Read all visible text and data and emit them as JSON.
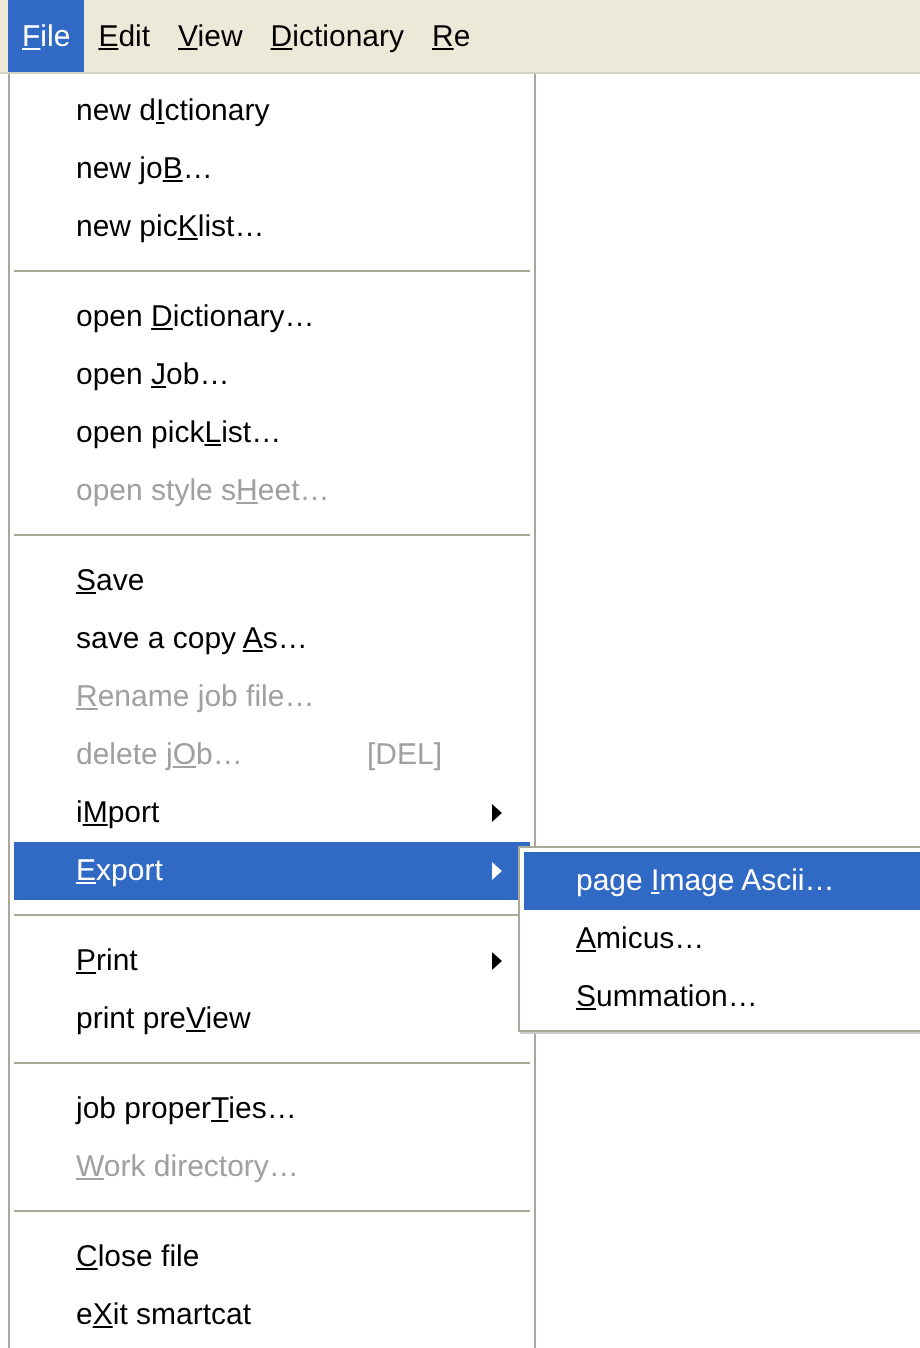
{
  "menu_bar": [
    {
      "label": {
        "key": "F",
        "after": "ile"
      },
      "selected": true
    },
    {
      "label": {
        "key": "E",
        "after": "dit"
      },
      "selected": false
    },
    {
      "label": {
        "key": "V",
        "after": "iew"
      },
      "selected": false
    },
    {
      "label": {
        "key": "D",
        "after": "ictionary"
      },
      "selected": false
    },
    {
      "label": {
        "key": "R",
        "after": "e"
      },
      "selected": false
    }
  ],
  "file_menu": [
    {
      "kind": "item",
      "label": {
        "before": "new d",
        "key": "I",
        "after": "ctionary"
      },
      "disabled": false,
      "selected": false
    },
    {
      "kind": "item",
      "label": {
        "before": "new jo",
        "key": "B",
        "after": "…"
      },
      "disabled": false,
      "selected": false
    },
    {
      "kind": "item",
      "label": {
        "before": "new pic",
        "key": "K",
        "after": "list…"
      },
      "disabled": false,
      "selected": false
    },
    {
      "kind": "separator"
    },
    {
      "kind": "item",
      "label": {
        "before": "open ",
        "key": "D",
        "after": "ictionary…"
      },
      "disabled": false,
      "selected": false
    },
    {
      "kind": "item",
      "label": {
        "before": "open ",
        "key": "J",
        "after": "ob…"
      },
      "disabled": false,
      "selected": false
    },
    {
      "kind": "item",
      "label": {
        "before": "open pick",
        "key": "L",
        "after": "ist…"
      },
      "disabled": false,
      "selected": false
    },
    {
      "kind": "item",
      "label": {
        "before": "open style s",
        "key": "H",
        "after": "eet…"
      },
      "disabled": true,
      "selected": false
    },
    {
      "kind": "separator"
    },
    {
      "kind": "item",
      "label": {
        "key": "S",
        "after": "ave"
      },
      "disabled": false,
      "selected": false
    },
    {
      "kind": "item",
      "label": {
        "before": "save a copy ",
        "key": "A",
        "after": "s…"
      },
      "disabled": false,
      "selected": false
    },
    {
      "kind": "item",
      "label": {
        "key": "R",
        "after": "ename job file…"
      },
      "disabled": true,
      "selected": false
    },
    {
      "kind": "item",
      "label": {
        "before": "delete j",
        "key": "O",
        "after": "b…"
      },
      "shortcut": "[DEL]",
      "disabled": true,
      "selected": false
    },
    {
      "kind": "submenu",
      "label": {
        "before": "i",
        "key": "M",
        "after": "port"
      },
      "disabled": false,
      "selected": false
    },
    {
      "kind": "submenu",
      "label": {
        "key": "E",
        "after": "xport"
      },
      "disabled": false,
      "selected": true,
      "children": [
        {
          "label": {
            "before": "page ",
            "key": "I",
            "after": "mage Ascii…"
          },
          "selected": true
        },
        {
          "label": {
            "key": "A",
            "after": "micus…"
          },
          "selected": false
        },
        {
          "label": {
            "key": "S",
            "after": "ummation…"
          },
          "selected": false
        }
      ]
    },
    {
      "kind": "separator"
    },
    {
      "kind": "submenu",
      "label": {
        "key": "P",
        "after": "rint"
      },
      "disabled": false,
      "selected": false
    },
    {
      "kind": "item",
      "label": {
        "before": "print pre",
        "key": "V",
        "after": "iew"
      },
      "disabled": false,
      "selected": false
    },
    {
      "kind": "separator"
    },
    {
      "kind": "item",
      "label": {
        "before": "job proper",
        "key": "T",
        "after": "ies…"
      },
      "disabled": false,
      "selected": false
    },
    {
      "kind": "item",
      "label": {
        "key": "W",
        "after": "ork directory…"
      },
      "disabled": true,
      "selected": false
    },
    {
      "kind": "separator"
    },
    {
      "kind": "item",
      "label": {
        "key": "C",
        "after": "lose file"
      },
      "disabled": false,
      "selected": false
    },
    {
      "kind": "item",
      "label": {
        "before": "e",
        "key": "X",
        "after": "it smartcat"
      },
      "disabled": false,
      "selected": false
    }
  ]
}
